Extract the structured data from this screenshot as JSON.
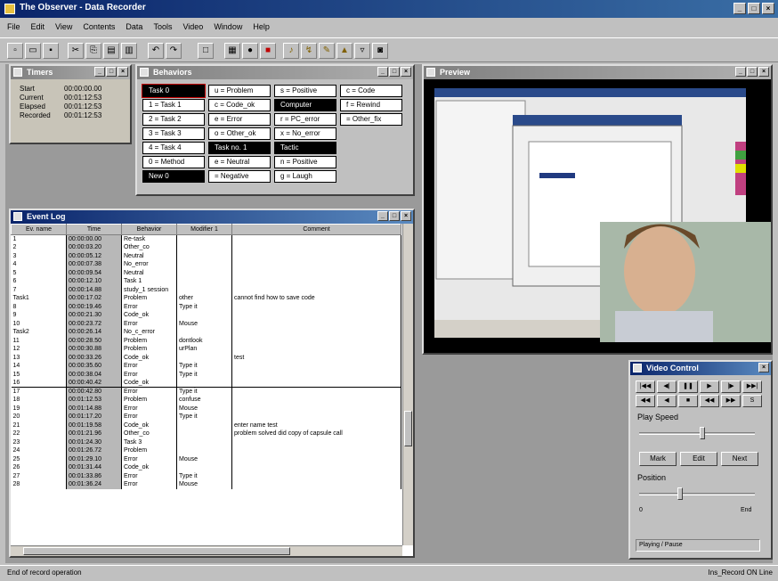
{
  "app": {
    "title": "The Observer - Data Recorder"
  },
  "menu": [
    "File",
    "Edit",
    "View",
    "Contents",
    "Data",
    "Tools",
    "Video",
    "Window",
    "Help"
  ],
  "toolbar": {
    "icons": [
      "new-icon",
      "open-icon",
      "save-icon",
      "cut-icon",
      "copy-icon",
      "paste-icon",
      "print-icon",
      "undo-icon",
      "redo-icon",
      "window-icon",
      "grid-icon",
      "record-icon",
      "stop-icon",
      "audio-icon",
      "event-icon",
      "mark-icon",
      "chart-icon",
      "filter-icon",
      "camera-icon"
    ]
  },
  "timer_window": {
    "title": "Timers",
    "rows": [
      {
        "label": "Start",
        "value": "00:00:00.00"
      },
      {
        "label": "Current",
        "value": "00:01:12:53"
      },
      {
        "label": "Elapsed",
        "value": "00:01:12:53"
      },
      {
        "label": "Recorded",
        "value": "00:01:12:53"
      }
    ]
  },
  "codes_window": {
    "title": "Behaviors",
    "columns": [
      [
        "Task 0",
        "1 = Task 1",
        "2 = Task 2",
        "3 = Task 3",
        "4 = Task 4",
        "0 = Method",
        "New 0"
      ],
      [
        "u = Problem",
        "c = Code_ok",
        "e = Error",
        "o = Other_ok",
        "Task no. 1",
        "e = Neutral",
        "= Negative"
      ],
      [
        "s = Positive",
        "Computer",
        "r = PC_error",
        "x = No_error",
        "Tactic",
        "n = Positive",
        "g = Laugh"
      ],
      [
        "c = Code",
        "f = Rewind",
        "= Other_fix"
      ]
    ]
  },
  "log_window": {
    "title": "Event Log",
    "headers": [
      "Ev. name",
      "Time",
      "Behavior",
      "Modifier 1",
      "Comment"
    ],
    "rows": [
      [
        "1",
        "00:00:00.00",
        "Re-task",
        "",
        ""
      ],
      [
        "2",
        "00:00:03.20",
        "Other_co",
        "",
        ""
      ],
      [
        "3",
        "00:00:05.12",
        "Neutral",
        "",
        ""
      ],
      [
        "4",
        "00:00:07.38",
        "No_error",
        "",
        ""
      ],
      [
        "5",
        "00:00:09.54",
        "Neutral",
        "",
        ""
      ],
      [
        "6",
        "00:00:12.10",
        "Task 1",
        "",
        ""
      ],
      [
        "7",
        "00:00:14.88",
        "study_1 session",
        "",
        ""
      ],
      [
        "Task1",
        "00:00:17.02",
        "Problem",
        "other",
        "cannot find how to save code"
      ],
      [
        "8",
        "00:00:19.46",
        "Error",
        "Type it",
        ""
      ],
      [
        "9",
        "00:00:21.30",
        "Code_ok",
        "",
        ""
      ],
      [
        "10",
        "00:00:23.72",
        "Error",
        "Mouse",
        ""
      ],
      [
        "Task2",
        "00:00:26.14",
        "No_c_error",
        "",
        ""
      ],
      [
        "11",
        "00:00:28.50",
        "Problem",
        "dontlook",
        ""
      ],
      [
        "12",
        "00:00:30.88",
        "Problem",
        "urPlan",
        ""
      ],
      [
        "13",
        "00:00:33.26",
        "Code_ok",
        "",
        "test"
      ],
      [
        "14",
        "00:00:35.60",
        "Error",
        "Type it",
        ""
      ],
      [
        "15",
        "00:00:38.04",
        "Error",
        "Type it",
        ""
      ],
      [
        "16",
        "00:00:40.42",
        "Code_ok",
        "",
        ""
      ],
      [
        "17",
        "00:00:42.80",
        "Error",
        "Type it",
        ""
      ],
      [
        "18",
        "00:01:12.53",
        "Problem",
        "confuse",
        ""
      ],
      [
        "19",
        "00:01:14.88",
        "Error",
        "Mouse",
        ""
      ],
      [
        "20",
        "00:01:17.20",
        "Error",
        "Type it",
        ""
      ],
      [
        "21",
        "00:01:19.58",
        "Code_ok",
        "",
        "enter name test"
      ],
      [
        "22",
        "00:01:21.96",
        "Other_co",
        "",
        "problem solved did copy of capsule call"
      ],
      [
        "23",
        "00:01:24.30",
        "Task 3",
        "",
        ""
      ],
      [
        "24",
        "00:01:26.72",
        "Problem",
        "",
        ""
      ],
      [
        "25",
        "00:01:29.10",
        "Error",
        "Mouse",
        ""
      ],
      [
        "26",
        "00:01:31.44",
        "Code_ok",
        "",
        ""
      ],
      [
        "27",
        "00:01:33.86",
        "Error",
        "Type it",
        ""
      ],
      [
        "28",
        "00:01:36.24",
        "Error",
        "Mouse",
        ""
      ]
    ]
  },
  "video_window": {
    "title": "Preview"
  },
  "player_window": {
    "title": "Video Control",
    "play_speed_label": "Play Speed",
    "position_label": "Position",
    "buttons": [
      "Mark",
      "Edit",
      "Next"
    ],
    "position_min": "0",
    "position_max": "End",
    "position_value": 0.35,
    "speed_value": 0.55,
    "status": "Playing / Pause"
  },
  "statusbar": {
    "left": "End of record operation",
    "right": "Ins_Record  ON Line"
  }
}
